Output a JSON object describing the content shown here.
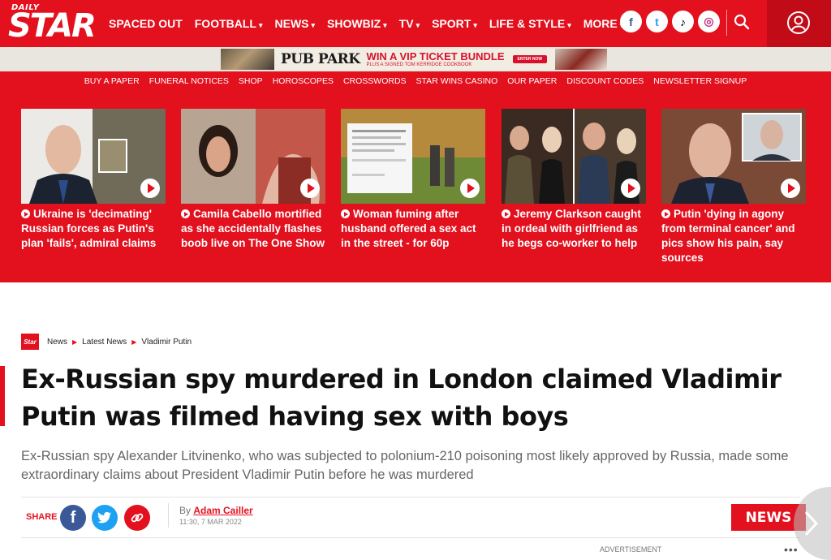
{
  "brand": {
    "logo_top": "DAILY",
    "logo_main": "STAR"
  },
  "topnav": {
    "links": [
      {
        "label": "SPACED OUT",
        "caret": ""
      },
      {
        "label": "FOOTBALL",
        "caret": "▾"
      },
      {
        "label": "NEWS",
        "caret": "▾"
      },
      {
        "label": "SHOWBIZ",
        "caret": "▾"
      },
      {
        "label": "TV",
        "caret": "▾"
      },
      {
        "label": "SPORT",
        "caret": "▾"
      },
      {
        "label": "LIFE & STYLE",
        "caret": "▾"
      },
      {
        "label": "MORE",
        "caret": "▾"
      }
    ],
    "social_icons": [
      "facebook-icon",
      "twitter-icon",
      "tiktok-icon",
      "instagram-icon"
    ],
    "social_glyphs": [
      "f",
      "t",
      "♪",
      "◎"
    ],
    "accent_color": "#e3101e"
  },
  "ad_banner": {
    "logo": "PUB PARK",
    "headline": "WIN A VIP TICKET BUNDLE",
    "subline": "PLUS A SIGNED TOM KERRIDGE COOKBOOK",
    "cta": "ENTER NOW"
  },
  "subnav": {
    "links": [
      "BUY A PAPER",
      "FUNERAL NOTICES",
      "SHOP",
      "HOROSCOPES",
      "CROSSWORDS",
      "STAR WINS CASINO",
      "OUR PAPER",
      "DISCOUNT CODES",
      "NEWSLETTER SIGNUP"
    ]
  },
  "stories": [
    {
      "title": "Ukraine is 'decimating' Russian forces as Putin's plan 'fails', admiral claims"
    },
    {
      "title": "Camila Cabello mortified as she accidentally flashes boob live on The One Show"
    },
    {
      "title": "Woman fuming after husband offered a sex act in the street - for 60p"
    },
    {
      "title": "Jeremy Clarkson caught in ordeal with girlfriend as he begs co-worker to help"
    },
    {
      "title": "Putin 'dying in agony from terminal cancer' and pics show his pain, say sources"
    }
  ],
  "breadcrumb": {
    "logo": "Star",
    "items": [
      "News",
      "Latest News",
      "Vladimir Putin"
    ]
  },
  "article": {
    "headline": "Ex-Russian spy murdered in London claimed Vladimir Putin was filmed having sex with boys",
    "standfirst": "Ex-Russian spy Alexander Litvinenko, who was subjected to polonium-210 poisoning most likely approved by Russia, made some extraordinary claims about President Vladimir Putin before he was murdered",
    "share_label": "SHARE",
    "by_prefix": "By ",
    "author": "Adam Cailler",
    "date": "11:30, 7 MAR 2022",
    "section_tag": "NEWS"
  },
  "advertisement_label": "ADVERTISEMENT",
  "ad_more": "•••"
}
